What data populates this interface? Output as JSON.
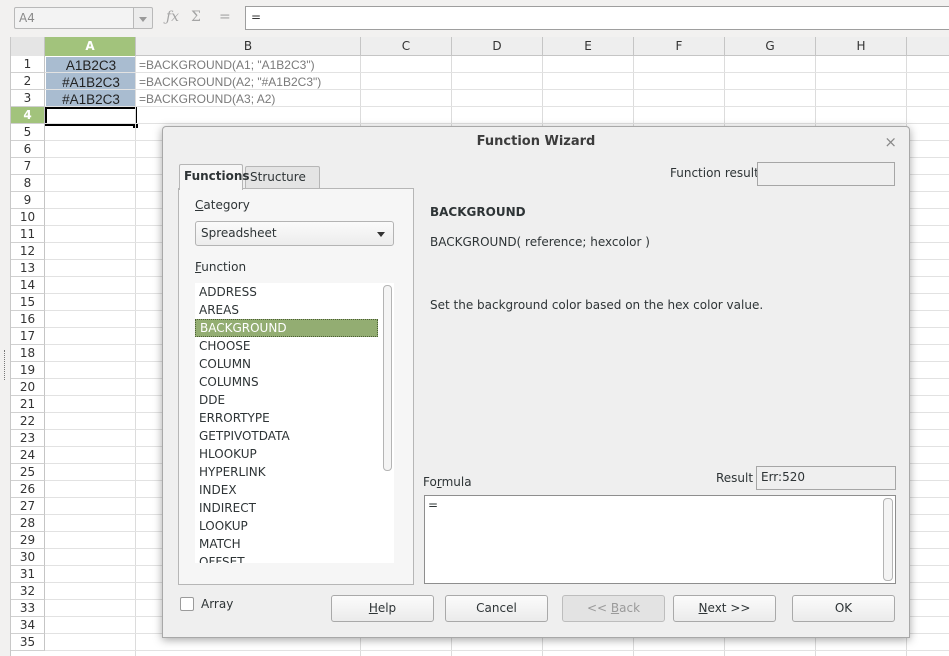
{
  "formula_bar": {
    "name_box": "A4",
    "formula": "=",
    "icons": [
      "function-wizard-icon",
      "sum-icon",
      "equals-icon"
    ],
    "fx_glyph": "ƒx",
    "sum_glyph": "Σ",
    "equals_glyph": "="
  },
  "sheet": {
    "columns": [
      "A",
      "B",
      "C",
      "D",
      "E",
      "F",
      "G",
      "H"
    ],
    "selected_column": "A",
    "rows": [
      "1",
      "2",
      "3",
      "4",
      "5",
      "6",
      "7",
      "8",
      "9",
      "10",
      "11",
      "12",
      "13",
      "14",
      "15",
      "16",
      "17",
      "18",
      "19",
      "20",
      "21",
      "22",
      "23",
      "24",
      "25",
      "26",
      "27",
      "28",
      "29",
      "30",
      "31",
      "32",
      "33",
      "34",
      "35"
    ],
    "selected_row": "4",
    "cells": [
      {
        "a": "A1B2C3",
        "b": "=BACKGROUND(A1; \"A1B2C3\")"
      },
      {
        "a": "#A1B2C3",
        "b": "=BACKGROUND(A2; \"#A1B2C3\")"
      },
      {
        "a": "#A1B2C3",
        "b": "=BACKGROUND(A3; A2)"
      }
    ],
    "cell_highlight_color": "#A1B2C3",
    "selection_color": "#a2c37c"
  },
  "dialog": {
    "title": "Function Wizard",
    "close_glyph": "×",
    "tabs": [
      "Functions",
      "Structure"
    ],
    "category_label": "Category",
    "category_value": "Spreadsheet",
    "function_label": "Function",
    "functions": [
      "ADDRESS",
      "AREAS",
      "BACKGROUND",
      "CHOOSE",
      "COLUMN",
      "COLUMNS",
      "DDE",
      "ERRORTYPE",
      "GETPIVOTDATA",
      "HLOOKUP",
      "HYPERLINK",
      "INDEX",
      "INDIRECT",
      "LOOKUP",
      "MATCH",
      "OFFSET"
    ],
    "selected_function": "BACKGROUND",
    "function_result_label": "Function result",
    "function_result_value": "",
    "fn_name": "BACKGROUND",
    "fn_signature": "BACKGROUND( reference; hexcolor )",
    "fn_description": "Set the background color based on the hex color value.",
    "formula_label": "Formula",
    "result_label": "Result",
    "result_value": "Err:520",
    "formula_value": "=",
    "array_label": "Array",
    "array_checked": false,
    "buttons": {
      "help": "Help",
      "cancel": "Cancel",
      "back": "<< Back",
      "next": "Next >>",
      "ok": "OK"
    }
  }
}
